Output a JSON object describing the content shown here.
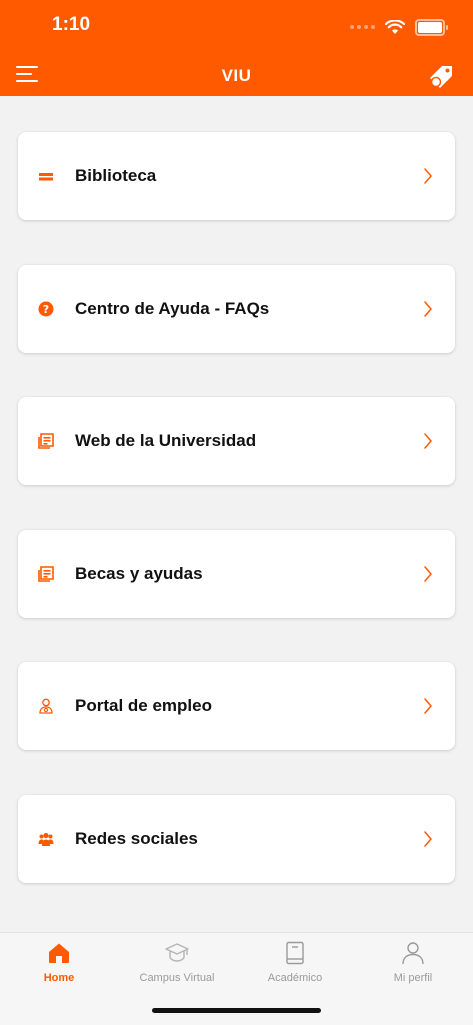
{
  "status_bar": {
    "time": "1:10"
  },
  "header": {
    "title": "VIU",
    "menu_icon": "menu-icon",
    "tag_icon": "tag-icon"
  },
  "colors": {
    "accent": "#ff5a00",
    "background": "#f2f2f2",
    "card": "#ffffff"
  },
  "menu_items": [
    {
      "label": "Biblioteca",
      "icon": "library-icon"
    },
    {
      "label": "Centro de Ayuda - FAQs",
      "icon": "help-icon"
    },
    {
      "label": "Web de la Universidad",
      "icon": "newspaper-icon"
    },
    {
      "label": "Becas y ayudas",
      "icon": "newspaper-icon"
    },
    {
      "label": "Portal de empleo",
      "icon": "employee-icon"
    },
    {
      "label": "Redes sociales",
      "icon": "group-icon"
    }
  ],
  "tabbar": {
    "tabs": [
      {
        "label": "Home",
        "icon": "home-icon",
        "active": true
      },
      {
        "label": "Campus Virtual",
        "icon": "graduation-cap-icon",
        "active": false
      },
      {
        "label": "Académico",
        "icon": "book-icon",
        "active": false
      },
      {
        "label": "Mi perfil",
        "icon": "user-icon",
        "active": false
      }
    ]
  }
}
